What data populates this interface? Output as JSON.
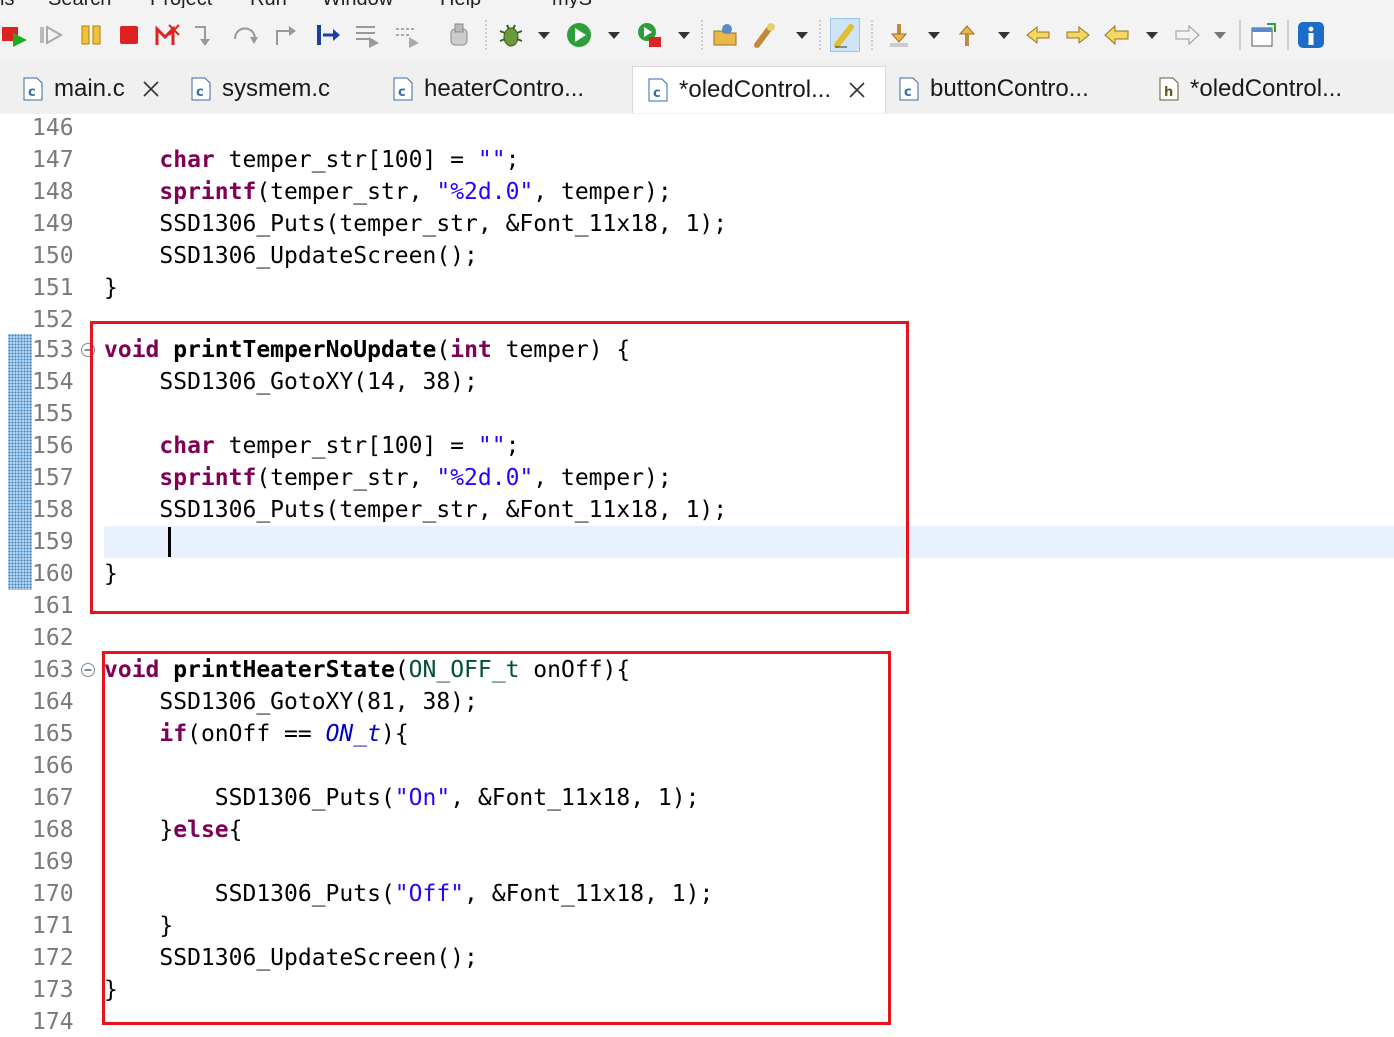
{
  "menu": {
    "items": [
      "ls",
      "Search",
      "Project",
      "Run",
      "Window",
      "Help",
      "myS"
    ]
  },
  "toolbar": {
    "icons": [
      "debug-launch-icon",
      "resume-icon",
      "suspend-icon",
      "terminate-icon",
      "disconnect-icon",
      "step-into-icon",
      "step-over-icon",
      "step-return-icon",
      "instruction-stepping-icon",
      "filters-icon",
      "use-step-filters-icon",
      "debug-icon",
      "run-icon",
      "external-tools-icon",
      "open-type-icon",
      "search-icon",
      "toggle-mark-occurrences-icon",
      "next-annotation-icon",
      "previous-annotation-icon",
      "last-edit-location-icon",
      "back-icon",
      "forward-icon",
      "open-perspective-icon",
      "info-icon"
    ]
  },
  "tabs": [
    {
      "label": "main.c",
      "type": "c",
      "closable": true,
      "active": false
    },
    {
      "label": "sysmem.c",
      "type": "c",
      "closable": false,
      "active": false
    },
    {
      "label": "heaterContro...",
      "type": "c",
      "closable": false,
      "active": false
    },
    {
      "label": "*oledControl...",
      "type": "c",
      "closable": true,
      "active": true
    },
    {
      "label": "buttonContro...",
      "type": "c",
      "closable": false,
      "active": false
    },
    {
      "label": "*oledControl...",
      "type": "h",
      "closable": false,
      "active": false
    }
  ],
  "editor": {
    "line_numbers": [
      "146",
      "147",
      "148",
      "149",
      "150",
      "151",
      "152",
      "153",
      "154",
      "155",
      "156",
      "157",
      "158",
      "159",
      "160",
      "161",
      "162",
      "163",
      "164",
      "165",
      "166",
      "167",
      "168",
      "169",
      "170",
      "171",
      "172",
      "173",
      "174"
    ],
    "current_line": "159",
    "highlight_color": "#e8121c",
    "colors": {
      "keyword": "#7f0055",
      "string": "#2a00ff",
      "current_line": "#e8f2fe"
    }
  }
}
